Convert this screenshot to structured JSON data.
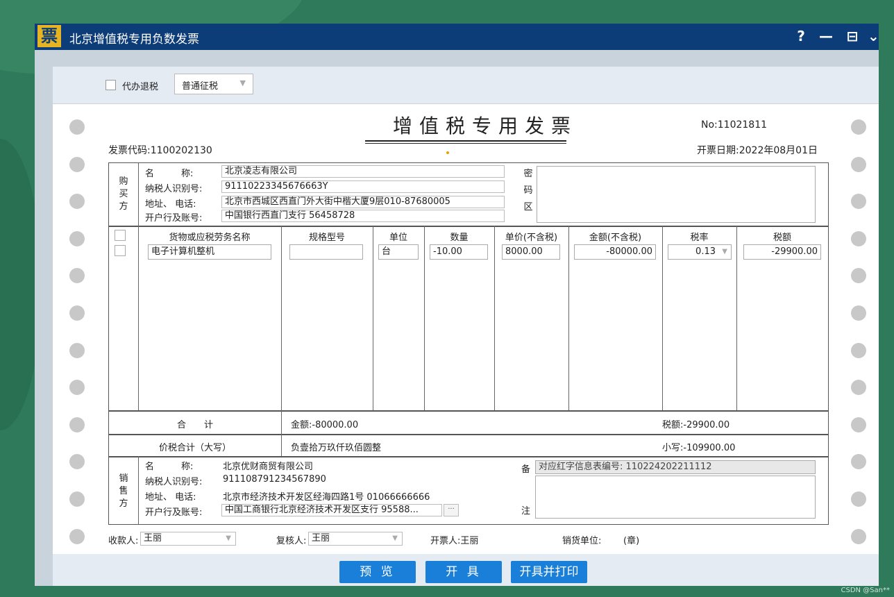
{
  "window": {
    "logo_char": "票",
    "title": "北京增值税专用负数发票",
    "help": "?",
    "minimize": "—",
    "maximize": "⊟",
    "close": "⌄"
  },
  "toolbar": {
    "agent_refund_label": "代办退税",
    "agent_refund_checked": false,
    "tax_type_selected": "普通征税"
  },
  "invoice": {
    "title": "增值税专用发票",
    "no": "No:11021811",
    "code": "发票代码:1100202130",
    "date": "开票日期:2022年08月01日"
  },
  "buyer": {
    "section_label": [
      "购",
      "买",
      "方"
    ],
    "labels": [
      "名　　　称:",
      "纳税人识别号:",
      "地址、 电话:",
      "开户行及账号:"
    ],
    "name": "北京凌志有限公司",
    "tax_id": "91110223345676663Y",
    "address_phone": "北京市西城区西直门外大街中楷大厦9层010-87680005",
    "bank_account": "中国银行西直门支行 56458728"
  },
  "cipher_label": [
    "密",
    "码",
    "区"
  ],
  "items": {
    "headers": [
      "货物或应税劳务名称",
      "规格型号",
      "单位",
      "数量",
      "单价(不含税)",
      "金额(不含税)",
      "税率",
      "税额"
    ],
    "rows": [
      {
        "name": "电子计算机整机",
        "spec": "",
        "unit": "台",
        "quantity": "-10.00",
        "unit_price": "8000.00",
        "amount": "-80000.00",
        "tax_rate": "0.13",
        "tax": "-29900.00"
      }
    ]
  },
  "totals": {
    "sum_label": "合　　计",
    "amount": "金额:-80000.00",
    "tax": "税额:-29900.00",
    "total_label": "价税合计（大写）",
    "total_words": "负壹拾万玖仟玖佰圆整",
    "total_small": "小写:-109900.00"
  },
  "seller": {
    "section_label": [
      "销",
      "售",
      "方"
    ],
    "labels": [
      "名　　　称:",
      "纳税人识别号:",
      "地址、 电话:",
      "开户行及账号:"
    ],
    "name": "北京优财商贸有限公司",
    "tax_id": "911108791234567890",
    "address_phone": "北京市经济技术开发区经海四路1号 01066666666",
    "bank_account": "中国工商银行北京经济技术开发区支行 95588...",
    "more": "···"
  },
  "remark": {
    "label_top": "备",
    "label_bottom": "注",
    "red_info": "对应红字信息表编号: 110224202211112"
  },
  "footer": {
    "payee_label": "收款人:",
    "payee": "王丽",
    "reviewer_label": "复核人:",
    "reviewer": "王丽",
    "issuer": "开票人:王丽",
    "seller_unit": "销货单位:",
    "seal": "(章)"
  },
  "actions": {
    "preview": "预 览",
    "issue": "开 具",
    "issue_print": "开具并打印"
  },
  "watermark": "CSDN @San**"
}
